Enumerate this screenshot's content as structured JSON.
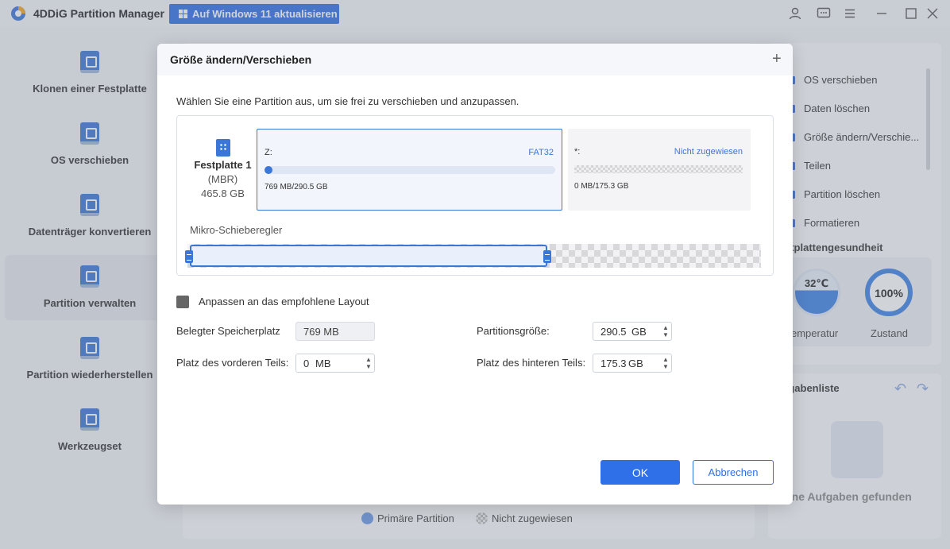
{
  "app": {
    "title": "4DDiG Partition Manager",
    "upgrade_label": "Auf Windows 11 aktualisieren"
  },
  "titlebar_icons": [
    "user-icon",
    "feedback-icon",
    "menu-icon",
    "minimize-icon",
    "maximize-icon",
    "close-icon"
  ],
  "sidebar": {
    "items": [
      {
        "label": "Klonen einer Festplatte",
        "icon": "clone-disk-icon"
      },
      {
        "label": "OS verschieben",
        "icon": "os-migrate-icon"
      },
      {
        "label": "Datenträger konvertieren",
        "icon": "convert-disk-icon"
      },
      {
        "label": "Partition verwalten",
        "icon": "manage-partition-icon",
        "active": true
      },
      {
        "label": "Partition wiederherstellen",
        "icon": "recover-partition-icon"
      },
      {
        "label": "Werkzeugset",
        "icon": "toolkit-icon"
      }
    ]
  },
  "right_panel": {
    "operations": [
      "OS verschieben",
      "Daten löschen",
      "Größe ändern/Verschie...",
      "Teilen",
      "Partition löschen",
      "Formatieren"
    ],
    "health_title": "stplattengesundheit",
    "temperature_value": "32℃",
    "temperature_label": "emperatur",
    "state_value": "100%",
    "state_label": "Zustand",
    "task_title": "fgabenliste",
    "task_empty": "eine Aufgaben gefunden"
  },
  "legend": {
    "primary": "Primäre Partition",
    "unallocated": "Nicht zugewiesen"
  },
  "dialog": {
    "title": "Größe ändern/Verschieben",
    "instruction": "Wählen Sie eine Partition aus, um sie frei zu verschieben und anzupassen.",
    "disk": {
      "name": "Festplatte 1",
      "type": "(MBR)",
      "size": "465.8 GB"
    },
    "partition_z": {
      "label": "Z:",
      "fs": "FAT32",
      "usage": "769 MB/290.5 GB",
      "used_fraction": 0.0026
    },
    "partition_unallocated": {
      "label": "*:",
      "fs": "Nicht zugewiesen",
      "usage": "0 MB/175.3 GB"
    },
    "micro_slider_label": "Mikro-Schieberegler",
    "slider_fraction": 0.6237,
    "recommend_layout_label": "Anpassen an das empfohlene Layout",
    "used_space_label": "Belegter Speicherplatz",
    "used_space_value": "769 MB",
    "partition_size_label": "Partitionsgröße:",
    "partition_size_value": "290.5",
    "partition_size_unit": "GB",
    "front_space_label": "Platz des vorderen Teils:",
    "front_space_value": "0",
    "front_space_unit": "MB",
    "back_space_label": "Platz des hinteren Teils:",
    "back_space_value": "175.3",
    "back_space_unit": "GB",
    "ok_label": "OK",
    "cancel_label": "Abbrechen"
  }
}
